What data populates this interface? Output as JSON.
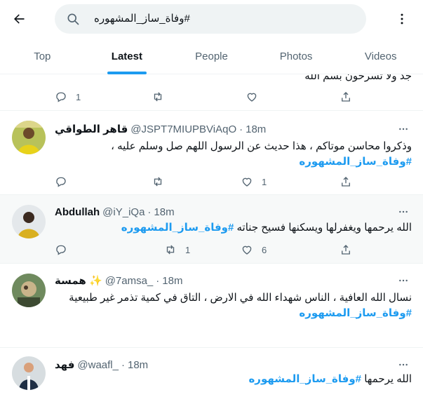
{
  "search": {
    "query": "#وفاة_ساز_المشهوره"
  },
  "tabs": [
    {
      "label": "Top",
      "active": false
    },
    {
      "label": "Latest",
      "active": true
    },
    {
      "label": "People",
      "active": false
    },
    {
      "label": "Photos",
      "active": false
    },
    {
      "label": "Videos",
      "active": false
    }
  ],
  "partial_tweet": {
    "text": "جد ولا تسرحون بسم الله",
    "reply_count": "1"
  },
  "tweets": [
    {
      "name": "قاهر الطواقي",
      "handle": "@JSPT7MIUPBViAqO",
      "time": "18m",
      "line1": "وذكروا محاسن موتاكم ، هذا حديث عن الرسول اللهم صل وسلم عليه ،",
      "hashtag": "#وفاة_ساز_المشهوره",
      "like_count": "1"
    },
    {
      "name": "Abdullah",
      "handle": "@iY_iQa",
      "time": "18m",
      "line1": "الله يرحمها ويغفرلها ويسكنها فسيح جناته",
      "hashtag": "#وفاة_ساز_المشهوره",
      "retweet_count": "1",
      "like_count": "6"
    },
    {
      "name": "همسة ✨",
      "handle": "@7amsa_",
      "time": "18m",
      "line1": "نسال الله العافية ، الناس شهداء الله في الارض ، التاق في كمية تذمر غير طبيعية",
      "hashtag": "#وفاة_ساز_المشهوره"
    },
    {
      "name": "فهد",
      "handle": "@waafl_",
      "time": "18m",
      "line1": "الله يرحمها",
      "hashtag": "#وفاة_ساز_المشهوره"
    }
  ],
  "colors": {
    "accent": "#1d9bf0",
    "text": "#0f1419",
    "muted": "#536471",
    "search_bg": "#eff3f4"
  },
  "icons": [
    "back-arrow-icon",
    "search-icon",
    "more-icon",
    "reply-icon",
    "retweet-icon",
    "like-icon",
    "share-icon",
    "caret-icon"
  ]
}
